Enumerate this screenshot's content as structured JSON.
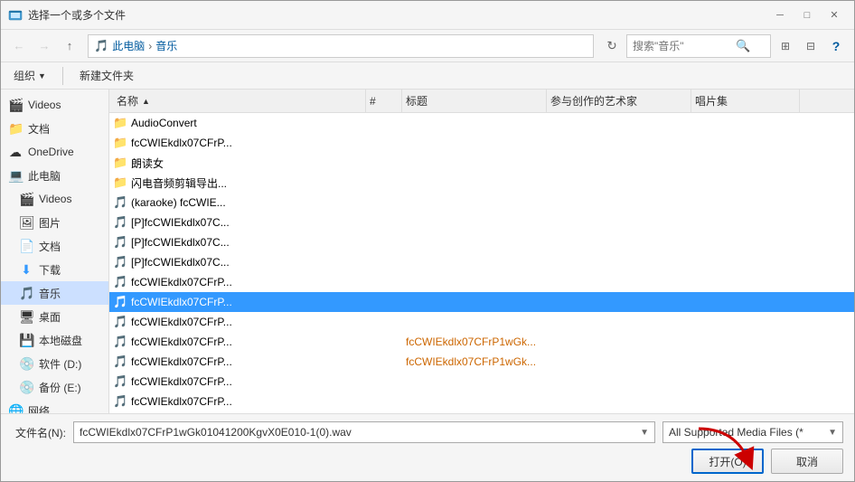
{
  "titleBar": {
    "title": "选择一个或多个文件",
    "closeBtn": "✕",
    "minBtn": "─",
    "maxBtn": "□"
  },
  "toolbar": {
    "backBtn": "←",
    "forwardBtn": "→",
    "upBtn": "↑",
    "addressParts": [
      "此电脑",
      "音乐"
    ],
    "searchPlaceholder": "搜索\"音乐\"",
    "viewBtn": "⊞",
    "paneBtn": "⊟",
    "helpBtn": "?"
  },
  "toolbar2": {
    "organizeLabel": "组织",
    "newFolderLabel": "新建文件夹"
  },
  "columns": {
    "name": "名称",
    "num": "#",
    "title": "标题",
    "artist": "参与创作的艺术家",
    "album": "唱片集"
  },
  "sidebar": {
    "items": [
      {
        "id": "videos-top",
        "icon": "🎬",
        "label": "Videos"
      },
      {
        "id": "documents",
        "icon": "📁",
        "label": "文档"
      },
      {
        "id": "onedrive",
        "icon": "☁",
        "label": "OneDrive"
      },
      {
        "id": "this-pc",
        "icon": "💻",
        "label": "此电脑"
      },
      {
        "id": "videos",
        "icon": "🎬",
        "label": "Videos"
      },
      {
        "id": "pictures",
        "icon": "🖼",
        "label": "图片"
      },
      {
        "id": "documents2",
        "icon": "📄",
        "label": "文档"
      },
      {
        "id": "downloads",
        "icon": "⬇",
        "label": "下载"
      },
      {
        "id": "music",
        "icon": "🎵",
        "label": "音乐",
        "active": true
      },
      {
        "id": "desktop",
        "icon": "🖥",
        "label": "桌面"
      },
      {
        "id": "local-disk",
        "icon": "💾",
        "label": "本地磁盘"
      },
      {
        "id": "software",
        "icon": "💿",
        "label": "软件 (D:)"
      },
      {
        "id": "backup",
        "icon": "💿",
        "label": "备份 (E:)"
      },
      {
        "id": "network",
        "icon": "🌐",
        "label": "网络"
      }
    ]
  },
  "files": [
    {
      "id": "f1",
      "type": "folder",
      "name": "AudioConvert",
      "num": "",
      "title": "",
      "artist": "",
      "album": ""
    },
    {
      "id": "f2",
      "type": "folder",
      "name": "fcCWIEkdlx07CFrP...",
      "num": "",
      "title": "",
      "artist": "",
      "album": ""
    },
    {
      "id": "f3",
      "type": "folder",
      "name": "朗读女",
      "num": "",
      "title": "",
      "artist": "",
      "album": ""
    },
    {
      "id": "f4",
      "type": "folder",
      "name": "闪电音频剪辑导出...",
      "num": "",
      "title": "",
      "artist": "",
      "album": ""
    },
    {
      "id": "f5",
      "type": "music",
      "name": "(karaoke) fcCWIE...",
      "num": "",
      "title": "",
      "artist": "",
      "album": ""
    },
    {
      "id": "f6",
      "type": "music",
      "name": "[P]fcCWIEkdlx07C...",
      "num": "",
      "title": "",
      "artist": "",
      "album": ""
    },
    {
      "id": "f7",
      "type": "music",
      "name": "[P]fcCWIEkdlx07C...",
      "num": "",
      "title": "",
      "artist": "",
      "album": ""
    },
    {
      "id": "f8",
      "type": "music",
      "name": "[P]fcCWIEkdlx07C...",
      "num": "",
      "title": "",
      "artist": "",
      "album": ""
    },
    {
      "id": "f9",
      "type": "music",
      "name": "fcCWIEkdlx07CFrP...",
      "num": "",
      "title": "",
      "artist": "",
      "album": ""
    },
    {
      "id": "f10",
      "type": "music",
      "name": "fcCWIEkdlx07CFrP...",
      "num": "",
      "title": "",
      "artist": "",
      "album": "",
      "selected": true
    },
    {
      "id": "f11",
      "type": "music",
      "name": "fcCWIEkdlx07CFrP...",
      "num": "",
      "title": "",
      "artist": "",
      "album": ""
    },
    {
      "id": "f12",
      "type": "music",
      "name": "fcCWIEkdlx07CFrP...",
      "num": "",
      "title": "fcCWIEkdlx07CFrP1wGk...",
      "artist": "",
      "album": ""
    },
    {
      "id": "f13",
      "type": "music",
      "name": "fcCWIEkdlx07CFrP...",
      "num": "",
      "title": "fcCWIEkdlx07CFrP1wGk...",
      "artist": "",
      "album": ""
    },
    {
      "id": "f14",
      "type": "music",
      "name": "fcCWIEkdlx07CFrP...",
      "num": "",
      "title": "",
      "artist": "",
      "album": ""
    },
    {
      "id": "f15",
      "type": "music",
      "name": "fcCWIEkdlx07CFrP...",
      "num": "",
      "title": "",
      "artist": "",
      "album": ""
    }
  ],
  "bottom": {
    "fileNameLabel": "文件名(N):",
    "fileNameValue": "fcCWIEkdlx07CFrP1wGk01041200KgvX0E010-1(0).wav",
    "fileTypeValue": "All Supported Media Files (*",
    "openBtnLabel": "打开(O)",
    "cancelBtnLabel": "取消"
  }
}
